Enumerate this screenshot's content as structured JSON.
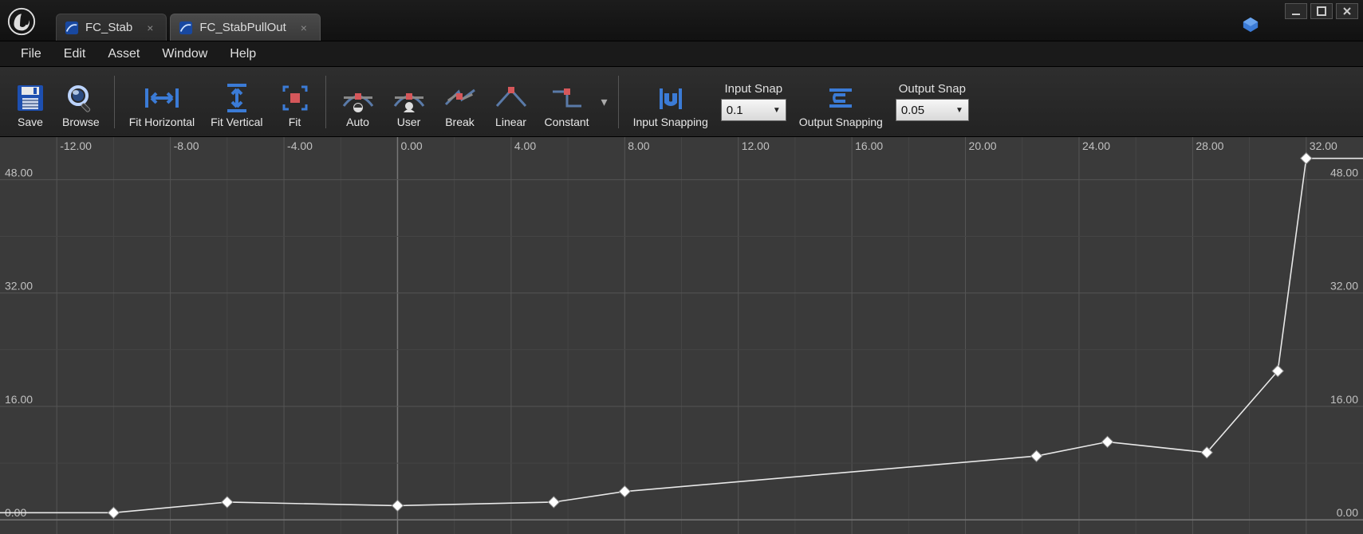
{
  "tabs": [
    {
      "label": "FC_Stab",
      "active": false
    },
    {
      "label": "FC_StabPullOut",
      "active": true
    }
  ],
  "menu": {
    "file": "File",
    "edit": "Edit",
    "asset": "Asset",
    "window": "Window",
    "help": "Help"
  },
  "toolbar": {
    "save": "Save",
    "browse": "Browse",
    "fit_h": "Fit Horizontal",
    "fit_v": "Fit Vertical",
    "fit": "Fit",
    "auto": "Auto",
    "user": "User",
    "break": "Break",
    "linear": "Linear",
    "constant": "Constant",
    "input_snapping": "Input Snapping",
    "output_snapping": "Output Snapping",
    "input_snap_label": "Input Snap",
    "input_snap_value": "0.1",
    "output_snap_label": "Output Snap",
    "output_snap_value": "0.05"
  },
  "chart_data": {
    "type": "line",
    "xlabel": "",
    "ylabel": "",
    "x_ticks": [
      "-12.00",
      "-8.00",
      "-4.00",
      "0.00",
      "4.00",
      "8.00",
      "12.00",
      "16.00",
      "20.00",
      "24.00",
      "28.00",
      "32.00"
    ],
    "y_ticks": [
      "0.00",
      "16.00",
      "32.00",
      "48.00"
    ],
    "xlim": [
      -14,
      34
    ],
    "ylim": [
      -2,
      54
    ],
    "series": [
      {
        "name": "FC_StabPullOut",
        "points": [
          {
            "x": -10.0,
            "y": 1.0
          },
          {
            "x": -6.0,
            "y": 2.5
          },
          {
            "x": 0.0,
            "y": 2.0
          },
          {
            "x": 5.5,
            "y": 2.5
          },
          {
            "x": 8.0,
            "y": 4.0
          },
          {
            "x": 22.5,
            "y": 9.0
          },
          {
            "x": 25.0,
            "y": 11.0
          },
          {
            "x": 28.5,
            "y": 9.5
          },
          {
            "x": 31.0,
            "y": 21.0
          },
          {
            "x": 32.0,
            "y": 51.0
          }
        ]
      }
    ]
  }
}
